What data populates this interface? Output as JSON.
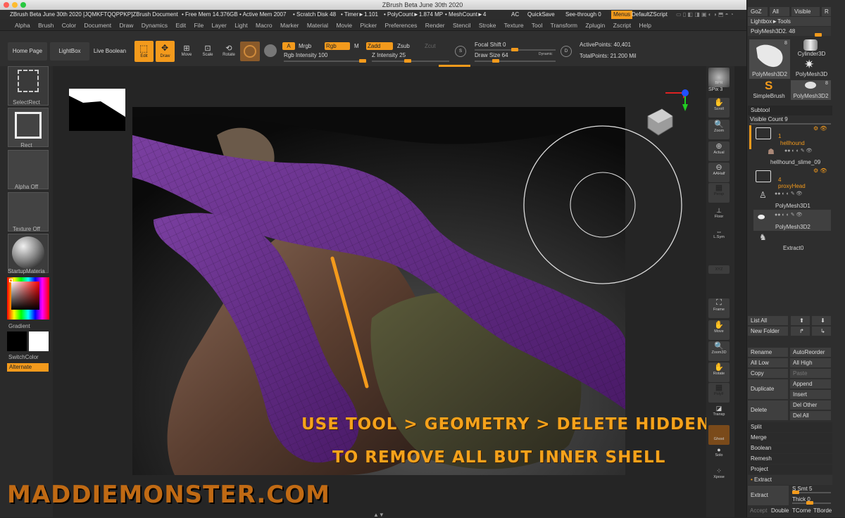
{
  "window": {
    "title": "ZBrush Beta June 30th 2020"
  },
  "status": {
    "doc": "ZBrush Beta June 30th 2020 [JQMKFTQQPPKP]ZBrush Document",
    "free_mem": "• Free Mem 14.376GB",
    "active_mem": "• Active Mem 2007",
    "scratch": "• Scratch Disk 48",
    "timer": "• Timer►1.101",
    "polycount": "• PolyCount►1.874 MP",
    "meshcount": "• MeshCount►4",
    "ac": "AC",
    "quicksave": "QuickSave",
    "seethrough": "See-through  0",
    "menus": "Menus",
    "default_zscript": "DefaultZScript"
  },
  "menu": [
    "Alpha",
    "Brush",
    "Color",
    "Document",
    "Draw",
    "Dynamics",
    "Edit",
    "File",
    "Layer",
    "Light",
    "Macro",
    "Marker",
    "Material",
    "Movie",
    "Picker",
    "Preferences",
    "Render",
    "Stencil",
    "Stroke",
    "Texture",
    "Tool",
    "Transform",
    "Zplugin",
    "Zscript",
    "Help"
  ],
  "toolbar": {
    "home_page": "Home Page",
    "lightbox": "LightBox",
    "live_boolean": "Live Boolean",
    "edit": "Edit",
    "draw": "Draw",
    "move": "Move",
    "scale": "Scale",
    "rotate": "Rotate",
    "a": "A",
    "mrgb": "Mrgb",
    "rgb": "Rgb",
    "m": "M",
    "zadd": "Zadd",
    "zsub": "Zsub",
    "zcut": "Zcut",
    "rgb_intensity": "Rgb Intensity 100",
    "z_intensity": "Z Intensity 25",
    "focal_shift": "Focal Shift 0",
    "draw_size": "Draw Size 64",
    "dynamic": "Dynamic",
    "active_points": "ActivePoints: 40,401",
    "total_points": "TotalPoints: 21.200 Mil"
  },
  "left_shelf": {
    "select_rect": "SelectRect",
    "rect": "Rect",
    "alpha_off": "Alpha Off",
    "texture_off": "Texture Off",
    "material": "StartupMateria",
    "gradient": "Gradient",
    "switch_color": "SwitchColor",
    "alternate": "Alternate"
  },
  "right_shelf": [
    "BPR",
    "SPix 3",
    "Scroll",
    "Zoom",
    "Actual",
    "AAHalf",
    "Persp",
    "Floor",
    "L.Sym",
    "XYZ",
    "Frame",
    "Move",
    "Zoom3D",
    "Rotate",
    "PolyF",
    "Transp",
    "Ghost",
    "Solo",
    "Xpose"
  ],
  "tray": {
    "top_buttons": [
      "GoZ",
      "All",
      "Visible",
      "R"
    ],
    "lightbox_tools": "Lightbox►Tools",
    "polymesh_slider": "PolyMesh3D2. 48",
    "tools": [
      {
        "name": "PolyMesh3D2",
        "count": "8"
      },
      {
        "name": "Cylinder3D",
        "count": ""
      },
      {
        "name": "PolyMesh3D",
        "count": ""
      },
      {
        "name": "SimpleBrush",
        "count": ""
      },
      {
        "name": "PolyMesh3D2",
        "count": "8"
      }
    ],
    "subtool_header": "Subtool",
    "visible_count": "Visible Count 9",
    "subtools": [
      {
        "label": "1",
        "name": "hellhound"
      },
      {
        "label": "",
        "name": "hellhound_slime_09"
      },
      {
        "label": "4",
        "name": "proxyHead"
      },
      {
        "label": "",
        "name": "PolyMesh3D1"
      },
      {
        "label": "",
        "name": "PolyMesh3D2"
      },
      {
        "label": "",
        "name": "Extract0"
      }
    ],
    "list_all": "List All",
    "new_folder": "New Folder",
    "rename": "Rename",
    "auto_reorder": "AutoReorder",
    "all_low": "All Low",
    "all_high": "All High",
    "copy": "Copy",
    "paste": "Paste",
    "duplicate": "Duplicate",
    "append": "Append",
    "insert": "Insert",
    "delete": "Delete",
    "del_other": "Del Other",
    "del_all": "Del All",
    "split": "Split",
    "merge": "Merge",
    "boolean": "Boolean",
    "remesh": "Remesh",
    "project": "Project",
    "extract_section": "Extract",
    "extract_btn": "Extract",
    "s_smt": "S Smt 5",
    "thick": "Thick 0",
    "accept": "Accept",
    "double": "Double",
    "tcorne": "TCorne",
    "tborde": "TBorde"
  },
  "annotation": {
    "line1": "USE TOOL > GEOMETRY > DELETE HIDDEN",
    "line2": "TO REMOVE ALL BUT INNER SHELL"
  },
  "watermark": "MADDIEMONSTER.COM",
  "colors": {
    "accent": "#f39a1c",
    "mesh_purple": "#6e2a8c",
    "panel": "#2e2e2e"
  }
}
